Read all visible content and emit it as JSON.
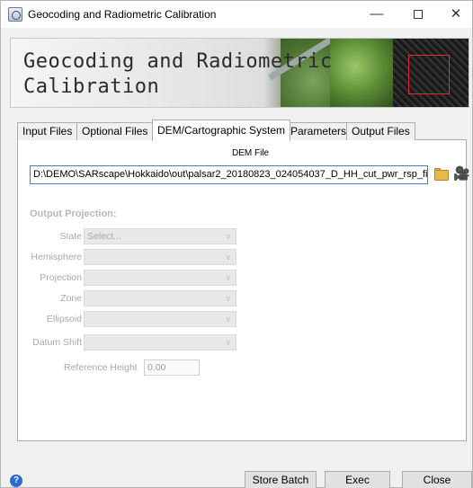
{
  "window": {
    "title": "Geocoding and Radiometric Calibration",
    "minimize_glyph": "—",
    "close_glyph": "✕"
  },
  "banner": {
    "title_line1": "Geocoding and Radiometric",
    "title_line2": "Calibration"
  },
  "tabs": [
    {
      "label": "Input Files",
      "active": false
    },
    {
      "label": "Optional Files",
      "active": false
    },
    {
      "label": "DEM/Cartographic System",
      "active": true
    },
    {
      "label": "Parameters",
      "active": false
    },
    {
      "label": "Output Files",
      "active": false
    }
  ],
  "dem": {
    "label": "DEM File",
    "path": "D:\\DEMO\\SARscape\\Hokkaido\\out\\palsar2_20180823_024054037_D_HH_cut_pwr_rsp_fil_d",
    "folder_icon": "folder-open-icon",
    "browse_icon": "binoculars-icon"
  },
  "output_projection": {
    "title": "Output Projection:",
    "fields": [
      {
        "label": "State",
        "value": "Select..."
      },
      {
        "label": "Hemisphere",
        "value": ""
      },
      {
        "label": "Projection",
        "value": ""
      },
      {
        "label": "Zone",
        "value": ""
      },
      {
        "label": "Ellipsoid",
        "value": ""
      },
      {
        "label": "Datum Shift",
        "value": ""
      }
    ],
    "reference_height_label": "Reference Height",
    "reference_height_value": "0.00"
  },
  "footer": {
    "help_icon": "help-icon",
    "store_batch": "Store Batch",
    "exec": "Exec",
    "close": "Close"
  },
  "colors": {
    "focus_border": "#3c7fd4",
    "disabled_text": "#a8a8a8",
    "help_blue": "#2d6bd2"
  }
}
